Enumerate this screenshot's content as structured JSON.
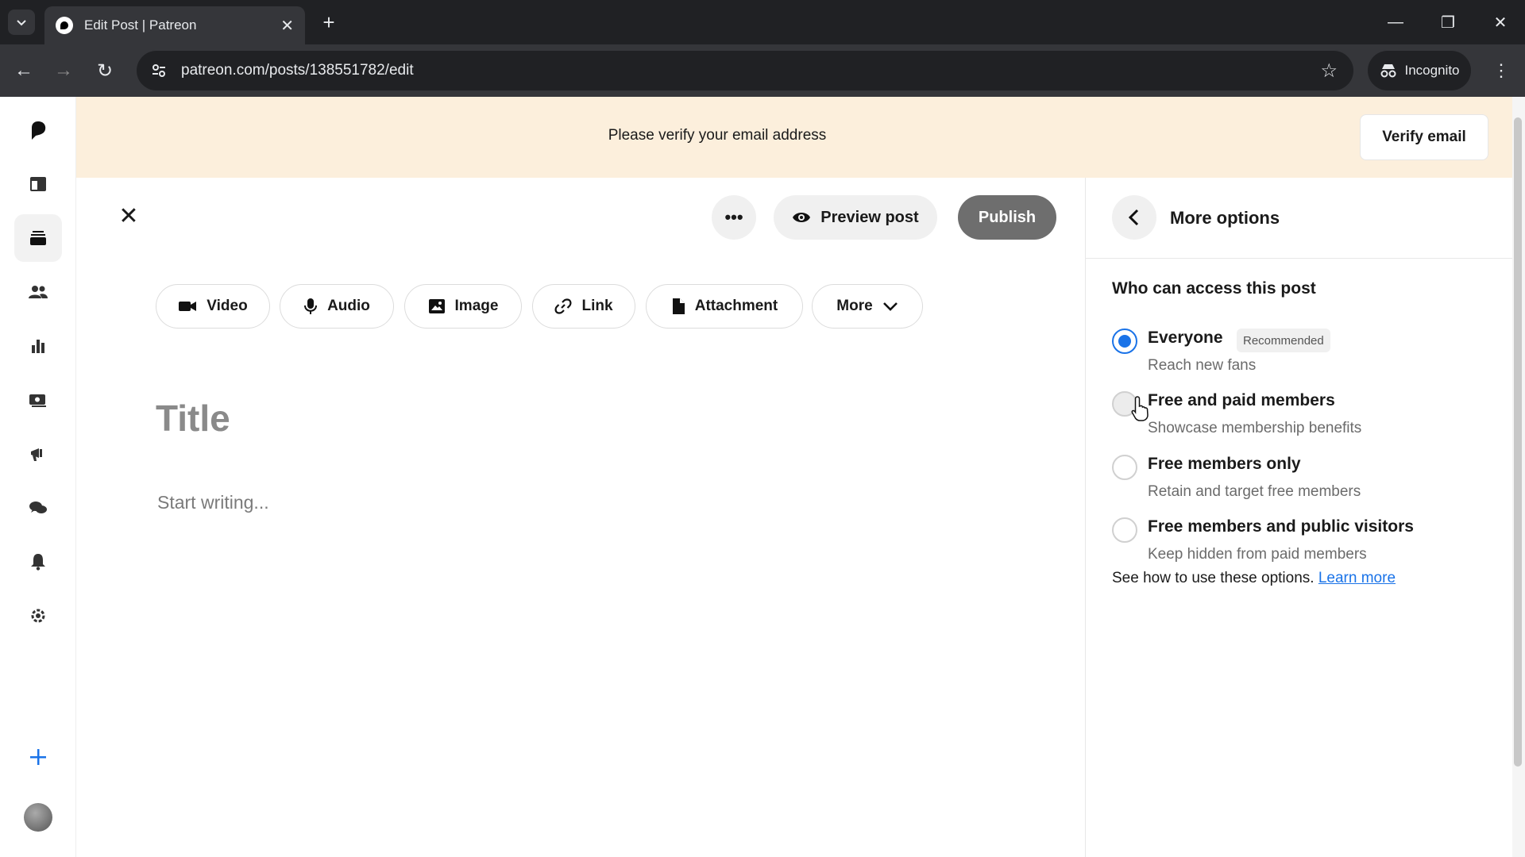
{
  "browser": {
    "tab_title": "Edit Post | Patreon",
    "url": "patreon.com/posts/138551782/edit",
    "incognito_label": "Incognito"
  },
  "banner": {
    "message": "Please verify your email address",
    "verify_button": "Verify email"
  },
  "editor": {
    "preview_label": "Preview post",
    "publish_label": "Publish",
    "media_buttons": {
      "video": "Video",
      "audio": "Audio",
      "image": "Image",
      "link": "Link",
      "attachment": "Attachment",
      "more": "More"
    },
    "title_placeholder": "Title",
    "body_placeholder": "Start writing..."
  },
  "panel": {
    "title": "More options",
    "section_title": "Who can access this post",
    "options": [
      {
        "label": "Everyone",
        "sub": "Reach new fans",
        "badge": "Recommended",
        "checked": true
      },
      {
        "label": "Free and paid members",
        "sub": "Showcase membership benefits",
        "checked": false
      },
      {
        "label": "Free members only",
        "sub": "Retain and target free members",
        "checked": false
      },
      {
        "label": "Free members and public visitors",
        "sub": "Keep hidden from paid members",
        "checked": false
      }
    ],
    "learn_prefix": "See how to use these options.",
    "learn_link": "Learn more"
  },
  "colors": {
    "accent": "#1a73e8",
    "banner_bg": "#fcefdc",
    "publish_bg": "#6e6e6e"
  }
}
